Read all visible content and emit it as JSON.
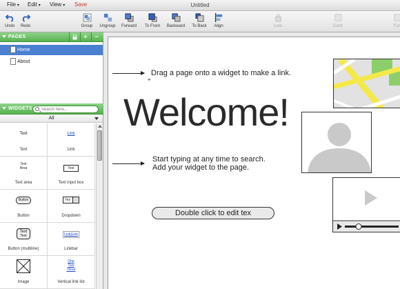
{
  "menubar": {
    "file": "File",
    "edit": "Edit",
    "view": "View",
    "save": "Save",
    "title": "Untitled"
  },
  "toolbar": {
    "undo": "Undo",
    "redo": "Redo",
    "group": "Group",
    "ungroup": "Ungroup",
    "forward": "Forward",
    "to_front": "To Front",
    "backward": "Backward",
    "to_back": "To Back",
    "align": "Align",
    "lock": "Lock",
    "color": "Color",
    "font": "Fon"
  },
  "pages_panel": {
    "title": "PAGES",
    "add": "+",
    "remove": "−",
    "items": [
      {
        "label": "Home",
        "selected": true
      },
      {
        "label": "About",
        "selected": false
      }
    ]
  },
  "widgets_panel": {
    "title": "WIDGETS",
    "search_placeholder": "Search here...",
    "filter": "All",
    "items": [
      {
        "label": "Text",
        "preview": "Text"
      },
      {
        "label": "Link",
        "preview": "Link"
      },
      {
        "label": "Text area",
        "preview": "Text\nArea"
      },
      {
        "label": "Text input box",
        "preview": "Text"
      },
      {
        "label": "Button",
        "preview": "Button"
      },
      {
        "label": "Dropdown",
        "preview": "Yes"
      },
      {
        "label": "Button (multiline)",
        "preview": "Text\nText"
      },
      {
        "label": "Linkbar",
        "preview": "Link|Link"
      },
      {
        "label": "Image",
        "preview": ""
      },
      {
        "label": "Vertical link list",
        "preview": "One\nTwo\nThree"
      }
    ]
  },
  "canvas": {
    "hint_link": "Drag a page onto a widget to make a link.",
    "welcome": "Welcome!",
    "hint_search_line1": "Start typing at any time to search.",
    "hint_search_line2": "Add your widget to the page.",
    "edit_button": "Double click to edit tex"
  },
  "colors": {
    "panel_green": "#57b24f",
    "selection_blue": "#4a7fd1",
    "save_red": "#c0392b",
    "map_yellow": "#f5e94a",
    "map_green": "#8ccf6a"
  }
}
